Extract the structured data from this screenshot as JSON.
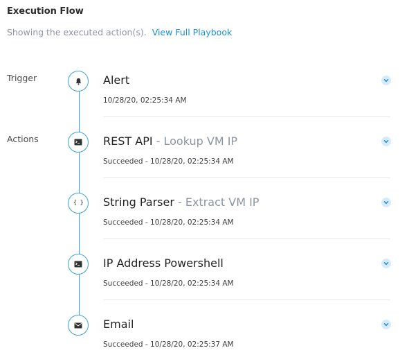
{
  "header": {
    "title": "Execution Flow",
    "subtitle": "Showing the executed action(s).",
    "link": "View Full Playbook"
  },
  "sections": {
    "trigger": "Trigger",
    "actions": "Actions"
  },
  "colors": {
    "accent": "#3aa2d9",
    "link": "#1a8fd6",
    "chevron_bg": "#d6ecfa",
    "muted": "#8a95a0"
  },
  "steps": [
    {
      "icon": "bell-icon",
      "name": "Alert",
      "desc": "",
      "status": "",
      "meta": "10/28/20, 02:25:34 AM"
    },
    {
      "icon": "terminal-icon",
      "name": "REST API",
      "desc": " - Lookup VM IP",
      "status": "Succeeded - ",
      "meta": "Succeeded - 10/28/20, 02:25:34 AM"
    },
    {
      "icon": "braces-icon",
      "name": "String Parser",
      "desc": " - Extract VM IP",
      "status": "Succeeded - ",
      "meta": "Succeeded - 10/28/20, 02:25:34 AM"
    },
    {
      "icon": "terminal-icon",
      "name": "IP Address Powershell",
      "desc": "",
      "status": "Succeeded - ",
      "meta": "Succeeded - 10/28/20, 02:25:34 AM"
    },
    {
      "icon": "envelope-icon",
      "name": "Email",
      "desc": "",
      "status": "Succeeded - ",
      "meta": "Succeeded - 10/28/20, 02:25:37 AM"
    }
  ]
}
